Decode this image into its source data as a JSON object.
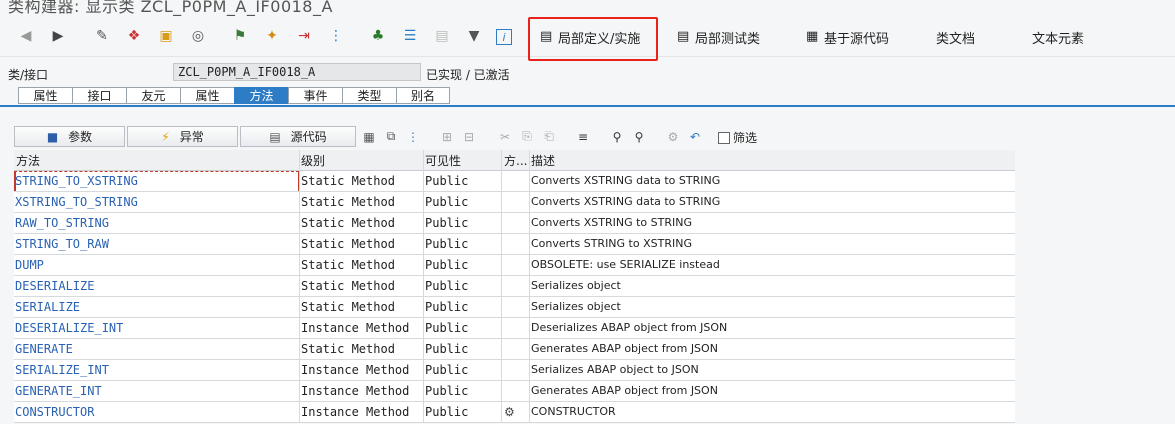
{
  "window": {
    "title": "类构建器: 显示类 ZCL_P0PM_A_IF0018_A"
  },
  "toolbar": {
    "buttons": [
      {
        "label": "局部定义/实施"
      },
      {
        "label": "局部测试类"
      },
      {
        "label": "基于源代码"
      },
      {
        "label": "类文档"
      },
      {
        "label": "文本元素"
      }
    ]
  },
  "class_info": {
    "label": "类/接口",
    "value": "ZCL_P0PM_A_IF0018_A",
    "status": "已实现 / 已激活"
  },
  "tabs": [
    {
      "label": "属性"
    },
    {
      "label": "接口"
    },
    {
      "label": "友元"
    },
    {
      "label": "属性"
    },
    {
      "label": "方法",
      "active": true
    },
    {
      "label": "事件"
    },
    {
      "label": "类型"
    },
    {
      "label": "别名"
    }
  ],
  "method_toolbar": {
    "params_label": "参数",
    "exceptions_label": "异常",
    "source_label": "源代码",
    "filter_label": "筛选"
  },
  "table": {
    "headers": [
      "方法",
      "级别",
      "可见性",
      "方...",
      "描述"
    ],
    "rows": [
      {
        "method": "STRING_TO_XSTRING",
        "level": "Static Method",
        "visibility": "Public",
        "desc": "Converts XSTRING data to STRING"
      },
      {
        "method": "XSTRING_TO_STRING",
        "level": "Static Method",
        "visibility": "Public",
        "desc": "Converts XSTRING data to STRING"
      },
      {
        "method": "RAW_TO_STRING",
        "level": "Static Method",
        "visibility": "Public",
        "desc": "Converts XSTRING to STRING"
      },
      {
        "method": "STRING_TO_RAW",
        "level": "Static Method",
        "visibility": "Public",
        "desc": "Converts STRING to XSTRING"
      },
      {
        "method": "DUMP",
        "level": "Static Method",
        "visibility": "Public",
        "desc": "OBSOLETE: use SERIALIZE instead"
      },
      {
        "method": "DESERIALIZE",
        "level": "Static Method",
        "visibility": "Public",
        "desc": "Serializes object"
      },
      {
        "method": "SERIALIZE",
        "level": "Static Method",
        "visibility": "Public",
        "desc": "Serializes object"
      },
      {
        "method": "DESERIALIZE_INT",
        "level": "Instance Method",
        "visibility": "Public",
        "desc": "Deserializes ABAP object from JSON"
      },
      {
        "method": "GENERATE",
        "level": "Static Method",
        "visibility": "Public",
        "desc": "Generates ABAP object from JSON"
      },
      {
        "method": "SERIALIZE_INT",
        "level": "Instance Method",
        "visibility": "Public",
        "desc": "Serializes ABAP object to JSON"
      },
      {
        "method": "GENERATE_INT",
        "level": "Instance Method",
        "visibility": "Public",
        "desc": "Generates ABAP object from JSON"
      },
      {
        "method": "CONSTRUCTOR",
        "level": "Instance Method",
        "visibility": "Public",
        "desc": "CONSTRUCTOR",
        "icon": "constructor-icon"
      }
    ]
  },
  "colors": {
    "accent": "#2d7dc6",
    "highlight": "#e8221b",
    "link": "#2a62b3"
  }
}
